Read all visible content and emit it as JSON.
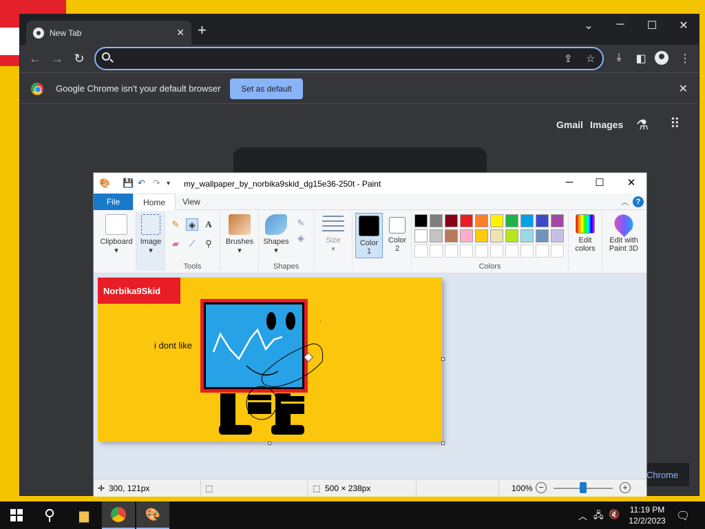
{
  "chrome": {
    "tab_title": "New Tab",
    "tab_close": "✕",
    "new_tab": "+",
    "omnibox_value": "",
    "infobar_message": "Google Chrome isn't your default browser",
    "set_default_label": "Set as default",
    "infobar_close": "✕",
    "gmail": "Gmail",
    "images": "Images",
    "customize": "Chrome"
  },
  "paint": {
    "title": "my_wallpaper_by_norbika9skid_dg15e36-250t - Paint",
    "tabs": {
      "file": "File",
      "home": "Home",
      "view": "View"
    },
    "groups": {
      "clipboard": "Clipboard",
      "image": "Image",
      "tools": "Tools",
      "brushes": "Brushes",
      "shapes_btn": "Shapes",
      "shapes": "Shapes",
      "size": "Size",
      "color1": "Color 1",
      "color1_a": "Color",
      "color1_b": "1",
      "color2_a": "Color",
      "color2_b": "2",
      "colors": "Colors",
      "edit_colors_a": "Edit",
      "edit_colors_b": "colors",
      "paint3d_a": "Edit with",
      "paint3d_b": "Paint 3D"
    },
    "palette_row1": [
      "#000000",
      "#7f7f7f",
      "#880015",
      "#ed1c24",
      "#ff7f27",
      "#fff200",
      "#22b14c",
      "#00a2e8",
      "#3f48cc",
      "#a349a4"
    ],
    "palette_row2": [
      "#ffffff",
      "#c3c3c3",
      "#b97a57",
      "#ffaec9",
      "#ffc90e",
      "#efe4b0",
      "#b5e61d",
      "#99d9ea",
      "#7092be",
      "#c8bfe7"
    ],
    "color1_value": "#000000",
    "color2_value": "#ffffff",
    "canvas": {
      "banner_text": "Norbika9Skid",
      "caption": "i dont like",
      "period": "."
    },
    "status": {
      "cursor_pos": "300, 121px",
      "image_size": "500 × 238px",
      "zoom": "100%",
      "zoom_fraction": 0.5
    }
  },
  "taskbar": {
    "time": "11:19 PM",
    "date": "12/2/2023"
  },
  "colors": {
    "accent_blue": "#8ab4f8",
    "paint_blue": "#1979ca",
    "canvas_yellow": "#fcc60c"
  }
}
